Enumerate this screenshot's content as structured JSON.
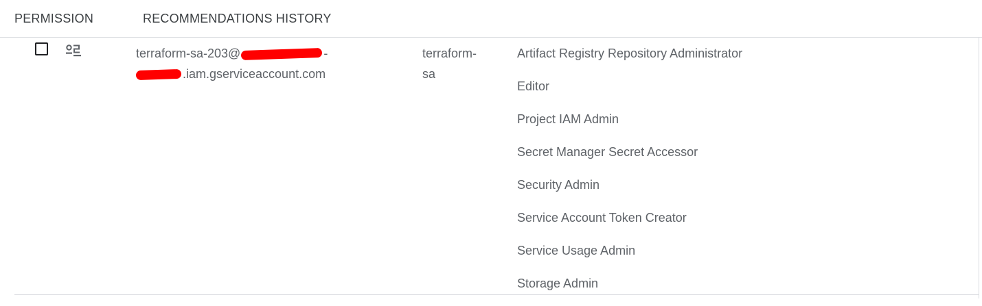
{
  "tabs": [
    {
      "label": "PERMISSION"
    },
    {
      "label": "RECOMMENDATIONS HISTORY"
    }
  ],
  "row": {
    "icon": "service-account-icon",
    "principal": {
      "line1_before": "terraform-sa-203@",
      "line1_after": "-",
      "line2_after": ".iam.gserviceaccount.com"
    },
    "name": {
      "line1": "terraform-",
      "line2": "sa"
    },
    "roles": [
      "Artifact Registry Repository Administrator",
      "Editor",
      "Project IAM Admin",
      "Secret Manager Secret Accessor",
      "Security Admin",
      "Service Account Token Creator",
      "Service Usage Admin",
      "Storage Admin"
    ]
  },
  "colors": {
    "text": "#5f6368",
    "tab_text": "#3c4043",
    "divider": "#dadce0",
    "redaction": "#ff0000"
  }
}
